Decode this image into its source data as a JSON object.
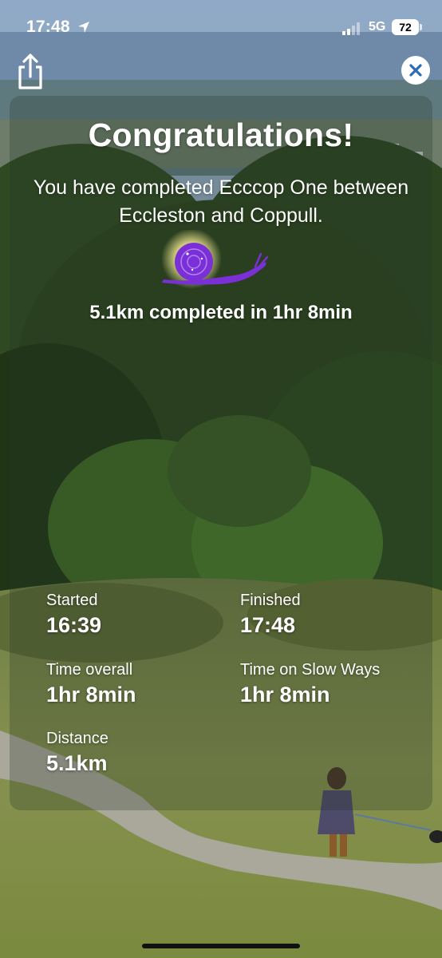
{
  "status_bar": {
    "time": "17:48",
    "network": "5G",
    "battery": "72",
    "icons": [
      "location-arrow-icon",
      "signal-bars-icon",
      "battery-icon"
    ]
  },
  "toolbar": {
    "share_icon": "share-icon",
    "close_icon": "close-icon"
  },
  "congrats": {
    "title": "Congratulations!",
    "subtitle": "You have completed Ecccop One between Eccleston and Coppull.",
    "badge_icon": "snail-icon",
    "summary": "5.1km completed in 1hr 8min"
  },
  "stats": {
    "started": {
      "label": "Started",
      "value": "16:39"
    },
    "finished": {
      "label": "Finished",
      "value": "17:48"
    },
    "time_overall": {
      "label": "Time overall",
      "value": "1hr 8min"
    },
    "time_on_slow_ways": {
      "label": "Time on Slow Ways",
      "value": "1hr 8min"
    },
    "distance": {
      "label": "Distance",
      "value": "5.1km"
    }
  },
  "colors": {
    "text": "#ffffff",
    "badge_purple": "#7b2fd6",
    "badge_glow": "#fff7b0",
    "close_button_bg": "#ffffff",
    "close_icon": "#2f6bb5"
  }
}
